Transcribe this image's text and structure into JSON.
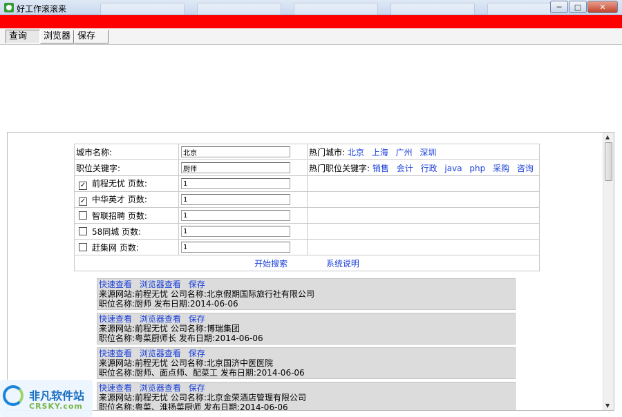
{
  "window": {
    "title": "好工作滚滚来",
    "min_icon": "minimize-icon",
    "max_icon": "maximize-icon",
    "close_icon": "close-icon"
  },
  "tabs": [
    {
      "label": "查询",
      "active": true
    },
    {
      "label": "浏览器",
      "active": false
    },
    {
      "label": "保存",
      "active": false
    }
  ],
  "colors": {
    "red_bar": "#ff0000",
    "link": "#1a3fd9",
    "result_bg": "#dcdcdc"
  },
  "form": {
    "city_label": "城市名称:",
    "city_value": "北京",
    "hot_cities_label": "热门城市:",
    "hot_cities": [
      "北京",
      "上海",
      "广州",
      "深圳"
    ],
    "keyword_label": "职位关键字:",
    "keyword_value": "厨师",
    "hot_keywords_label": "热门职位关键字:",
    "hot_keywords": [
      "销售",
      "会计",
      "行政",
      "java",
      "php",
      "采购",
      "咨询"
    ],
    "pages_label": "页数:",
    "sources": [
      {
        "name": "前程无忧",
        "checked": true,
        "pages": "1"
      },
      {
        "name": "中华英才",
        "checked": true,
        "pages": "1"
      },
      {
        "name": "智联招聘",
        "checked": false,
        "pages": "1"
      },
      {
        "name": "58同城",
        "checked": false,
        "pages": "1"
      },
      {
        "name": "赶集网",
        "checked": false,
        "pages": "1"
      }
    ],
    "search_button": "开始搜索",
    "help_button": "系统说明"
  },
  "result_actions": {
    "quick_view": "快速查看",
    "browser_view": "浏览器查看",
    "save": "保存"
  },
  "result_labels": {
    "source": "来源网站:",
    "company": "公司名称:",
    "position": "职位名称:",
    "date": "发布日期:"
  },
  "results": [
    {
      "source": "前程无忧",
      "company": "北京假期国际旅行社有限公司",
      "position": "厨师",
      "date": "2014-06-06"
    },
    {
      "source": "前程无忧",
      "company": "博瑞集团",
      "position": "粤菜厨师长",
      "date": "2014-06-06"
    },
    {
      "source": "前程无忧",
      "company": "北京国济中医医院",
      "position": "厨师、面点师、配菜工",
      "date": "2014-06-06"
    },
    {
      "source": "前程无忧",
      "company": "北京金荣酒店管理有限公司",
      "position": "粤菜、淮扬菜厨师",
      "date": "2014-06-06"
    }
  ],
  "watermark": {
    "cn": "非凡软件站",
    "en": "CRSKY.com"
  }
}
